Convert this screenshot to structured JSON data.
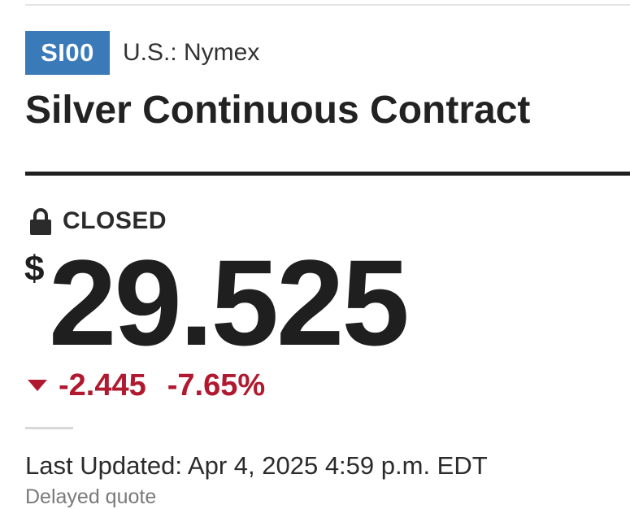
{
  "quote": {
    "ticker": "SI00",
    "exchange": "U.S.: Nymex",
    "name": "Silver Continuous Contract",
    "status": "CLOSED",
    "status_icon": "lock-icon",
    "currency_symbol": "$",
    "price": "29.525",
    "change": "-2.445",
    "change_percent": "-7.65%",
    "direction_icon": "down-triangle-icon",
    "last_updated": "Last Updated: Apr 4, 2025 4:59 p.m. EDT",
    "delay_note": "Delayed quote"
  },
  "colors": {
    "badge": "#3a7ab8",
    "negative": "#b0192f",
    "text": "#222222",
    "muted": "#7a7a7a"
  }
}
